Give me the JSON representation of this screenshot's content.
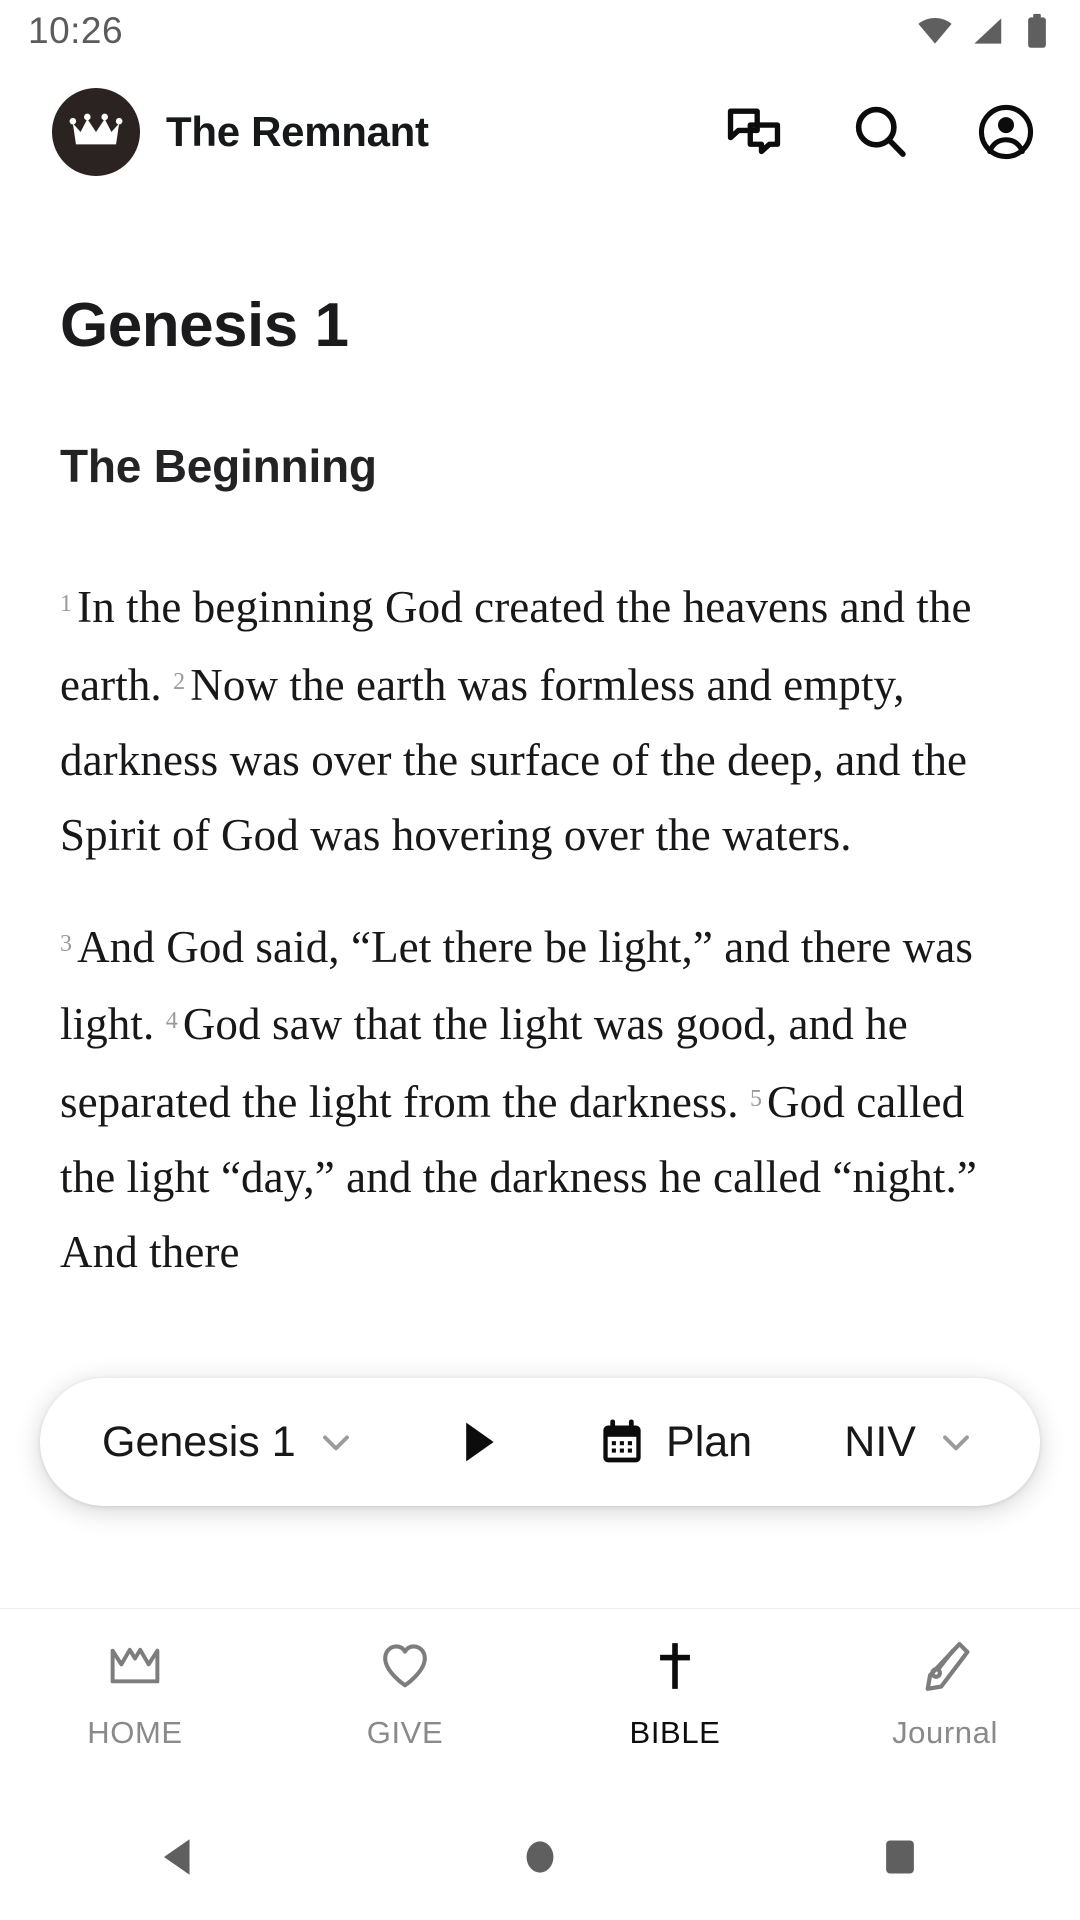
{
  "status": {
    "time": "10:26",
    "icons": [
      "wifi-icon",
      "cellular-signal-icon",
      "battery-icon"
    ]
  },
  "header": {
    "logo_icon": "crown-logo-icon",
    "logo_bg": "#2b2321",
    "brand": "The Remnant",
    "actions": [
      {
        "name": "chat-icon",
        "label": "Chat"
      },
      {
        "name": "search-icon",
        "label": "Search"
      },
      {
        "name": "account-icon",
        "label": "Account"
      }
    ]
  },
  "reader": {
    "chapter_title": "Genesis 1",
    "section_heading": "The Beginning",
    "paragraphs": [
      {
        "verses": [
          {
            "num": "1",
            "text": "In the beginning God created the heavens and the earth."
          },
          {
            "num": "2",
            "text": "Now the earth was formless and empty, darkness was over the surface of the deep, and the Spirit of God was hovering over the waters."
          }
        ]
      },
      {
        "verses": [
          {
            "num": "3",
            "text": "And God said, “Let there be light,” and there was light."
          },
          {
            "num": "4",
            "text": "God saw that the light was good, and he separated the light from the darkness."
          },
          {
            "num": "5",
            "text": "God called the light “day,” and the darkness he called “night.” And there"
          }
        ]
      }
    ]
  },
  "pill": {
    "chapter_selector": "Genesis 1",
    "chapter_chevron": "chevron-down-icon",
    "play_icon": "play-icon",
    "plan_icon": "calendar-icon",
    "plan_label": "Plan",
    "version_selector": "NIV",
    "version_chevron": "chevron-down-icon"
  },
  "tabs": [
    {
      "icon": "crown-icon",
      "label": "HOME",
      "active": false
    },
    {
      "icon": "heart-icon",
      "label": "GIVE",
      "active": false
    },
    {
      "icon": "cross-icon",
      "label": "BIBLE",
      "active": true
    },
    {
      "icon": "pen-nib-icon",
      "label": "Journal",
      "active": false
    }
  ],
  "android_nav": [
    {
      "name": "back-button",
      "icon": "triangle-back-icon"
    },
    {
      "name": "home-button",
      "icon": "circle-home-icon"
    },
    {
      "name": "recents-button",
      "icon": "square-recents-icon"
    }
  ],
  "colors": {
    "accent": "#2b2321",
    "text": "#18181a",
    "muted": "#8a8a8a"
  }
}
